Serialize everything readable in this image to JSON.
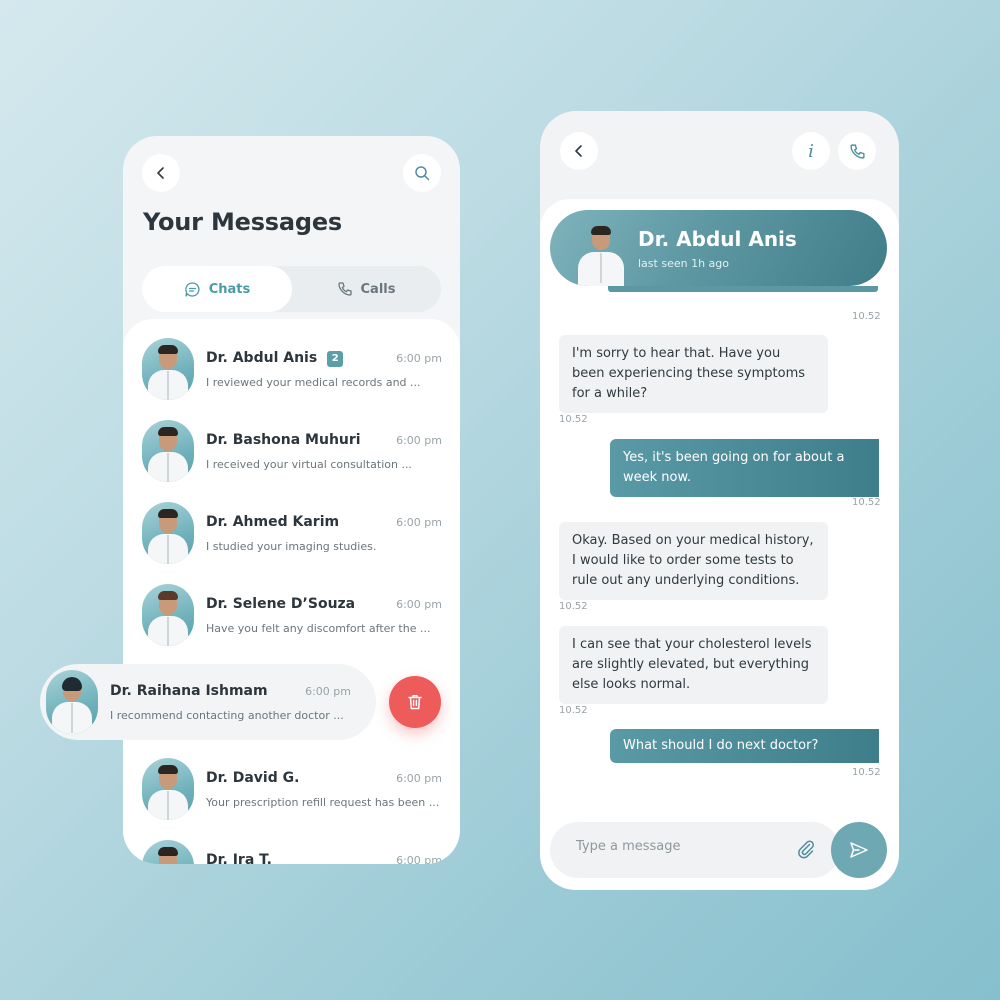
{
  "colors": {
    "accent": "#5b9ea9",
    "delete": "#ee5b5b",
    "outgoing_bubble": "#3d7e8a",
    "incoming_bubble": "#f0f2f3"
  },
  "messages_screen": {
    "title": "Your Messages",
    "back_icon": "chevron-left-icon",
    "search_icon": "search-icon",
    "tabs": [
      {
        "label": "Chats",
        "icon": "chat-bubble-icon",
        "active": true
      },
      {
        "label": "Calls",
        "icon": "phone-icon",
        "active": false
      }
    ],
    "conversations": [
      {
        "name": "Dr. Abdul Anis",
        "badge": "2",
        "time": "6:00 pm",
        "preview": "I reviewed your medical records and ..."
      },
      {
        "name": "Dr. Bashona Muhuri",
        "time": "6:00 pm",
        "preview": " I received your virtual consultation ..."
      },
      {
        "name": "Dr. Ahmed Karim",
        "time": "6:00 pm",
        "preview": "I studied your imaging studies."
      },
      {
        "name": "Dr. Selene D’Souza",
        "time": "6:00 pm",
        "preview": "Have you felt any discomfort after the ..."
      },
      {
        "name": "Dr. Raihana Ishmam",
        "time": "6:00 pm",
        "preview": "I recommend contacting another doctor ..."
      },
      {
        "name": "Dr. David G.",
        "time": "6:00 pm",
        "preview": "Your prescription refill request has been ..."
      },
      {
        "name": "Dr. Ira T.",
        "time": "6:00 pm",
        "preview": ""
      }
    ],
    "delete_icon": "trash-icon"
  },
  "chat_screen": {
    "doctor_name": "Dr. Abdul Anis",
    "status": "last seen 1h ago",
    "info_glyph": "i",
    "first_stamp": "10.52",
    "messages": [
      {
        "direction": "in",
        "text": "I'm sorry to hear that. Have you been experiencing these symptoms for a while?",
        "time": "10.52"
      },
      {
        "direction": "out",
        "text": "Yes, it's been going on for about a week now.",
        "time": "10.52"
      },
      {
        "direction": "in",
        "text": "Okay. Based on your medical history, I would like to order some tests to rule out any underlying conditions.",
        "time": "10.52"
      },
      {
        "direction": "in",
        "text": "I can see that your cholesterol levels are slightly elevated, but everything else looks normal.",
        "time": "10.52"
      },
      {
        "direction": "out",
        "text": "What should I do next doctor?",
        "time": "10.52"
      }
    ],
    "composer": {
      "placeholder": "Type a message",
      "value": ""
    }
  }
}
